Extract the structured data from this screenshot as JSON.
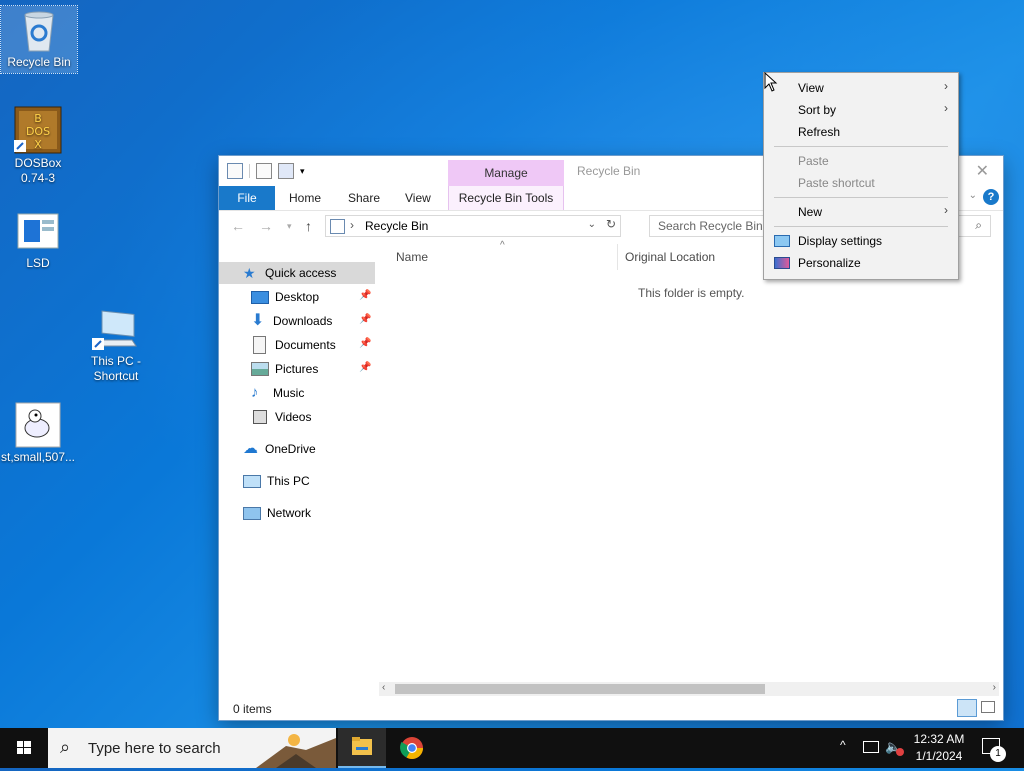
{
  "desktop": {
    "icons": [
      {
        "label": "Recycle Bin",
        "icon": "recycle-bin-icon"
      },
      {
        "label": "DOSBox\n0.74-3",
        "line1": "DOSBox",
        "line2": "0.74-3",
        "icon": "dosbox-icon",
        "art": "B DOS X"
      },
      {
        "label": "LSD",
        "icon": "lsd-file-icon"
      },
      {
        "line1": "This PC -",
        "line2": "Shortcut",
        "icon": "this-pc-shortcut-icon"
      },
      {
        "label": "st,small,507...",
        "icon": "image-file-icon"
      }
    ]
  },
  "explorer": {
    "manage_tab": "Manage",
    "title": "Recycle Bin",
    "close": "✕",
    "ribbon_tabs": [
      "File",
      "Home",
      "Share",
      "View",
      "Recycle Bin Tools"
    ],
    "help": "?",
    "address": "Recycle Bin",
    "search_placeholder": "Search Recycle Bin",
    "nav": {
      "quick_access": "Quick access",
      "items": [
        {
          "label": "Desktop",
          "icon": "desktop-folder-icon",
          "pinned": true
        },
        {
          "label": "Downloads",
          "icon": "downloads-icon",
          "pinned": true
        },
        {
          "label": "Documents",
          "icon": "documents-icon",
          "pinned": true
        },
        {
          "label": "Pictures",
          "icon": "pictures-icon",
          "pinned": true
        },
        {
          "label": "Music",
          "icon": "music-icon",
          "pinned": false
        },
        {
          "label": "Videos",
          "icon": "videos-icon",
          "pinned": false
        }
      ],
      "onedrive": "OneDrive",
      "this_pc": "This PC",
      "network": "Network"
    },
    "columns": {
      "name": "Name",
      "original_location": "Original Location"
    },
    "empty_message": "This folder is empty.",
    "status": "0 items"
  },
  "context_menu": {
    "view": "View",
    "sort_by": "Sort by",
    "refresh": "Refresh",
    "paste": "Paste",
    "paste_shortcut": "Paste shortcut",
    "new": "New",
    "display_settings": "Display settings",
    "personalize": "Personalize"
  },
  "taskbar": {
    "search_placeholder": "Type here to search",
    "time": "12:32 AM",
    "date": "1/1/2024",
    "notification_count": "1"
  },
  "colors": {
    "accent": "#1979ca",
    "manage_tab": "#efc8f6",
    "taskbar": "#101010"
  }
}
